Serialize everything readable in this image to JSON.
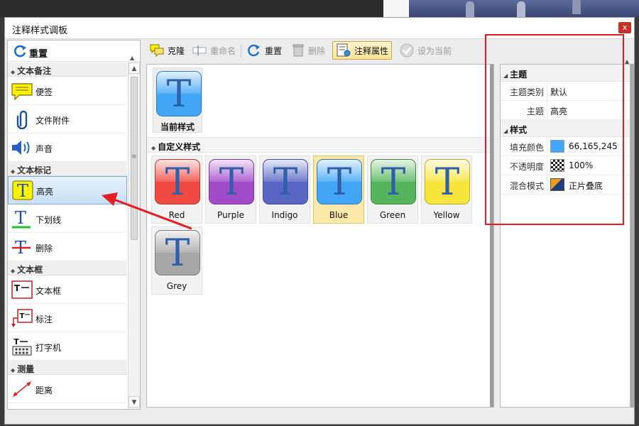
{
  "window": {
    "title": "注释样式调板",
    "close_label": "x"
  },
  "left_panel": {
    "reset_label": "重置",
    "groups": [
      {
        "label": "文本备注",
        "items": [
          "便签",
          "文件附件",
          "声音"
        ]
      },
      {
        "label": "文本标记",
        "items": [
          "高亮",
          "下划线",
          "删除"
        ],
        "active": "高亮"
      },
      {
        "label": "文本框",
        "items": [
          "文本框",
          "标注",
          "打字机"
        ]
      },
      {
        "label": "测量",
        "items": [
          "距离"
        ]
      }
    ]
  },
  "toolbar": {
    "clone": "克隆",
    "rename": "重命名",
    "reset": "重置",
    "delete": "删除",
    "annotation_props": "注释属性",
    "set_current": "设为当前"
  },
  "center_panel": {
    "current_label": "当前样式",
    "custom_section": "自定义样式",
    "styles": [
      {
        "name": "Red",
        "color": "#f04a43"
      },
      {
        "name": "Purple",
        "color": "#a24bc9"
      },
      {
        "name": "Indigo",
        "color": "#5966c4"
      },
      {
        "name": "Blue",
        "color": "#42a5f5",
        "selected": true
      },
      {
        "name": "Green",
        "color": "#56b45c"
      },
      {
        "name": "Yellow",
        "color": "#f7e53b"
      },
      {
        "name": "Grey",
        "color": "#a7a7a7"
      }
    ],
    "icon_letter": "T"
  },
  "properties": {
    "categories": [
      {
        "label": "主题",
        "rows": [
          {
            "key": "主题类别",
            "value": "默认"
          },
          {
            "key": "主题",
            "value": "高亮"
          }
        ]
      },
      {
        "label": "样式",
        "rows": [
          {
            "key": "填充颜色",
            "value": "66,165,245",
            "swatch": "#42a5f5"
          },
          {
            "key": "不透明度",
            "value": "100%"
          },
          {
            "key": "混合模式",
            "value": "正片叠底"
          }
        ]
      }
    ]
  },
  "colors": {
    "accent_red": "#e51c23",
    "fill_blue": "#42a5f5",
    "selection": "#fde9a9"
  }
}
